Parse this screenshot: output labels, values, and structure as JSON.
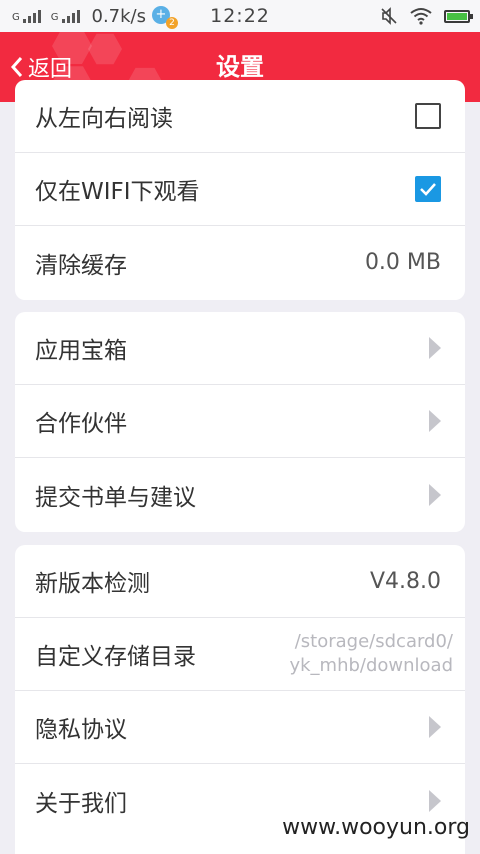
{
  "status_bar": {
    "signal_label_1": "G",
    "signal_label_2": "G",
    "speed": "0.7k/s",
    "data_badge": "2",
    "time": "12:22",
    "battery_color": "#47c043"
  },
  "header": {
    "back_label": "返回",
    "title": "设置",
    "background_color": "#f22a40"
  },
  "group1": {
    "read_ltr_label": "从左向右阅读",
    "read_ltr_checked": false,
    "wifi_only_label": "仅在WIFI下观看",
    "wifi_only_checked": true,
    "clear_cache_label": "清除缓存",
    "clear_cache_value": "0.0 MB"
  },
  "group2": {
    "app_box_label": "应用宝箱",
    "partners_label": "合作伙伴",
    "feedback_label": "提交书单与建议"
  },
  "group3": {
    "version_check_label": "新版本检测",
    "version_value": "V4.8.0",
    "storage_dir_label": "自定义存储目录",
    "storage_path_line1": "/storage/sdcard0/",
    "storage_path_line2": "yk_mhb/download",
    "privacy_label": "隐私协议",
    "about_label": "关于我们"
  },
  "watermark": "www.wooyun.org",
  "accent_checkbox_color": "#1a98e3"
}
